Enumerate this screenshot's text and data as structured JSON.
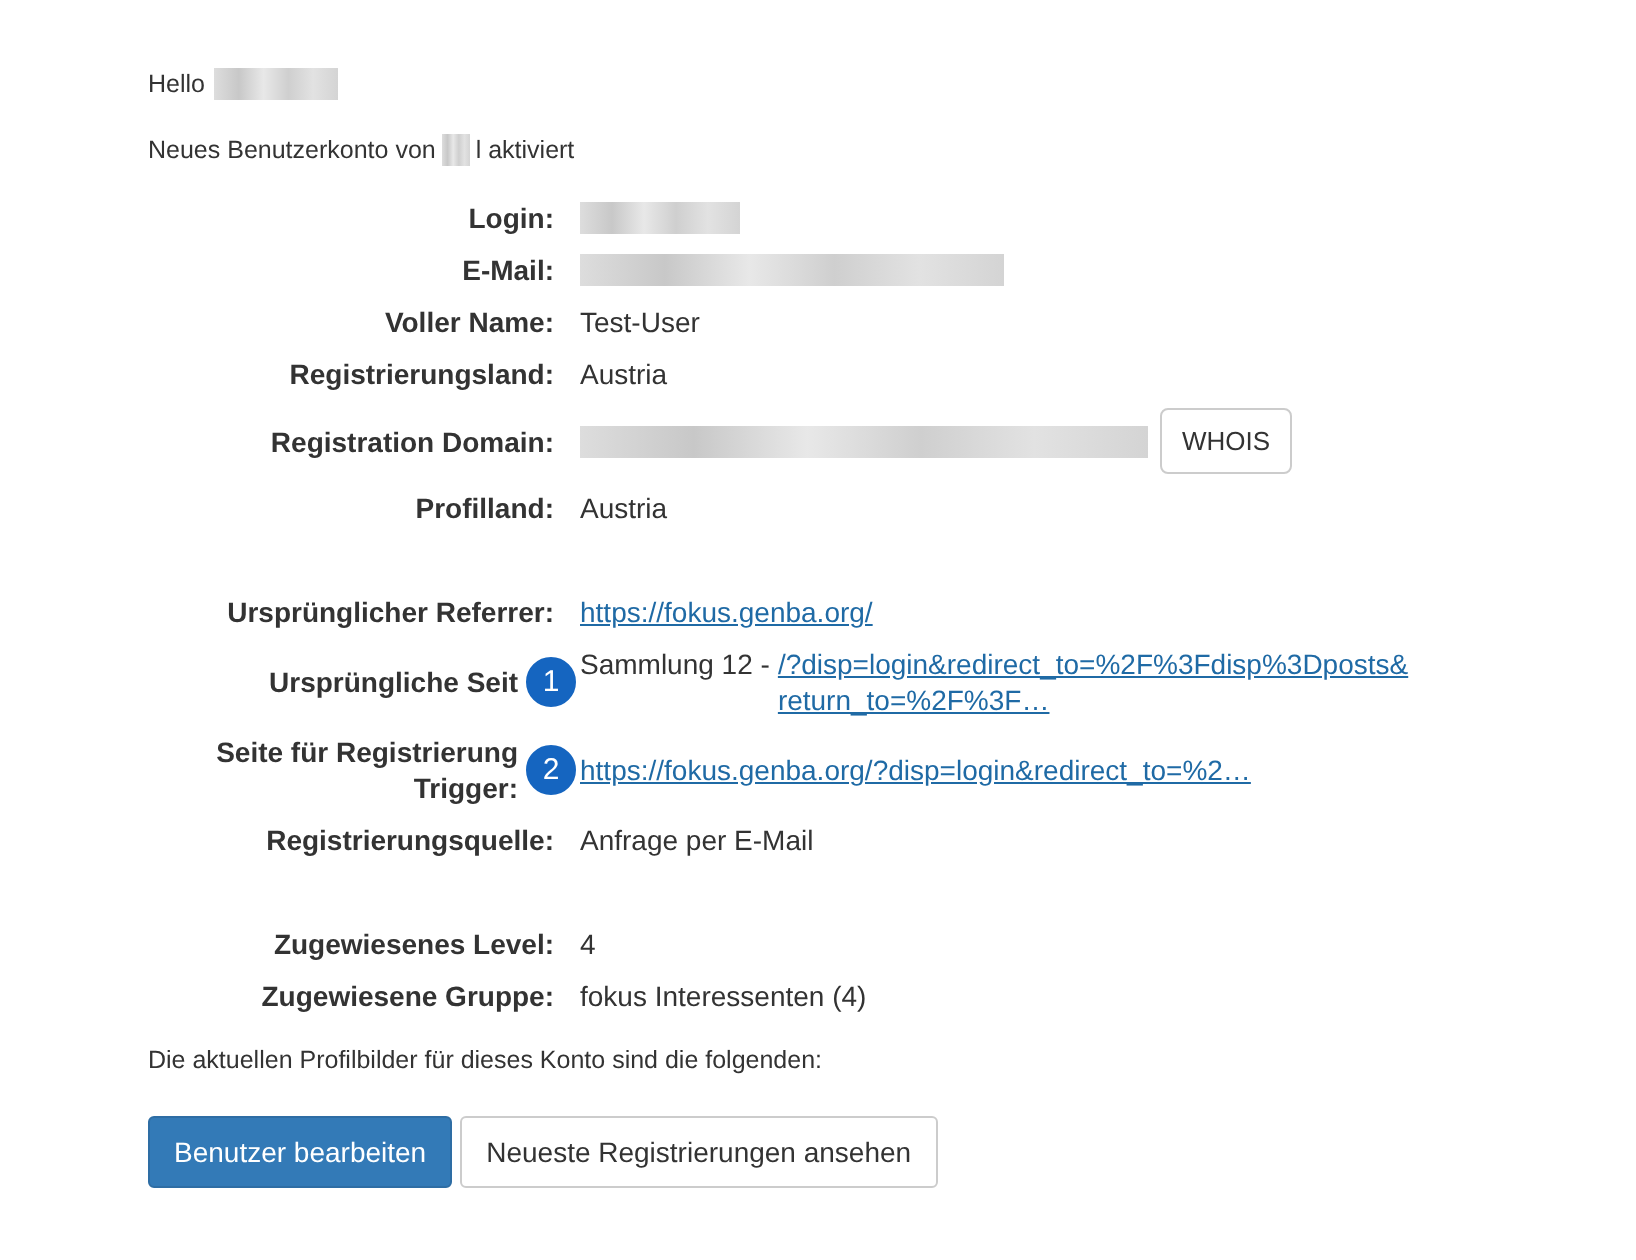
{
  "greeting": {
    "text": "Hello",
    "name_redacted": true
  },
  "notice": {
    "before": "Neues Benutzerkonto von",
    "redacted": true,
    "after": "l aktiviert"
  },
  "groups": [
    [
      {
        "label": "Login:",
        "kind": "redacted"
      },
      {
        "label": "E-Mail:",
        "kind": "redacted"
      },
      {
        "label": "Voller Name:",
        "kind": "text",
        "value": "Test-User"
      },
      {
        "label": "Registrierungsland:",
        "kind": "text",
        "value": "Austria"
      },
      {
        "label": "Registration Domain:",
        "kind": "redacted",
        "button": "WHOIS"
      },
      {
        "label": "Profilland:",
        "kind": "text",
        "value": "Austria"
      }
    ],
    [
      {
        "label": "Ursprünglicher Referrer:",
        "kind": "link",
        "link_lines": [
          "https://fokus.genba.org/"
        ]
      },
      {
        "label": "Ursprüngliche Seit",
        "kind": "link",
        "badge": "1",
        "prefix": "Sammlung 12 -",
        "link_lines": [
          "/?disp=login&redirect_to=%2F%3Fdisp%3Dposts&",
          "return_to=%2F%3F…"
        ]
      },
      {
        "label_lines": [
          "Seite für Registrierung",
          "Trigger:"
        ],
        "kind": "link",
        "badge": "2",
        "link_lines": [
          "https://fokus.genba.org/?disp=login&redirect_to=%2…"
        ]
      },
      {
        "label": "Registrierungsquelle:",
        "kind": "text",
        "value": "Anfrage per E-Mail"
      }
    ],
    [
      {
        "label": "Zugewiesenes Level:",
        "kind": "text",
        "value": "4"
      },
      {
        "label": "Zugewiesene Gruppe:",
        "kind": "text",
        "value": "fokus Interessenten (4)"
      }
    ]
  ],
  "footer_text": "Die aktuellen Profilbilder für dieses Konto sind die folgenden:",
  "buttons": [
    {
      "label": "Benutzer bearbeiten",
      "kind": "primary"
    },
    {
      "label": "Neueste Registrierungen ansehen",
      "kind": "default"
    }
  ]
}
